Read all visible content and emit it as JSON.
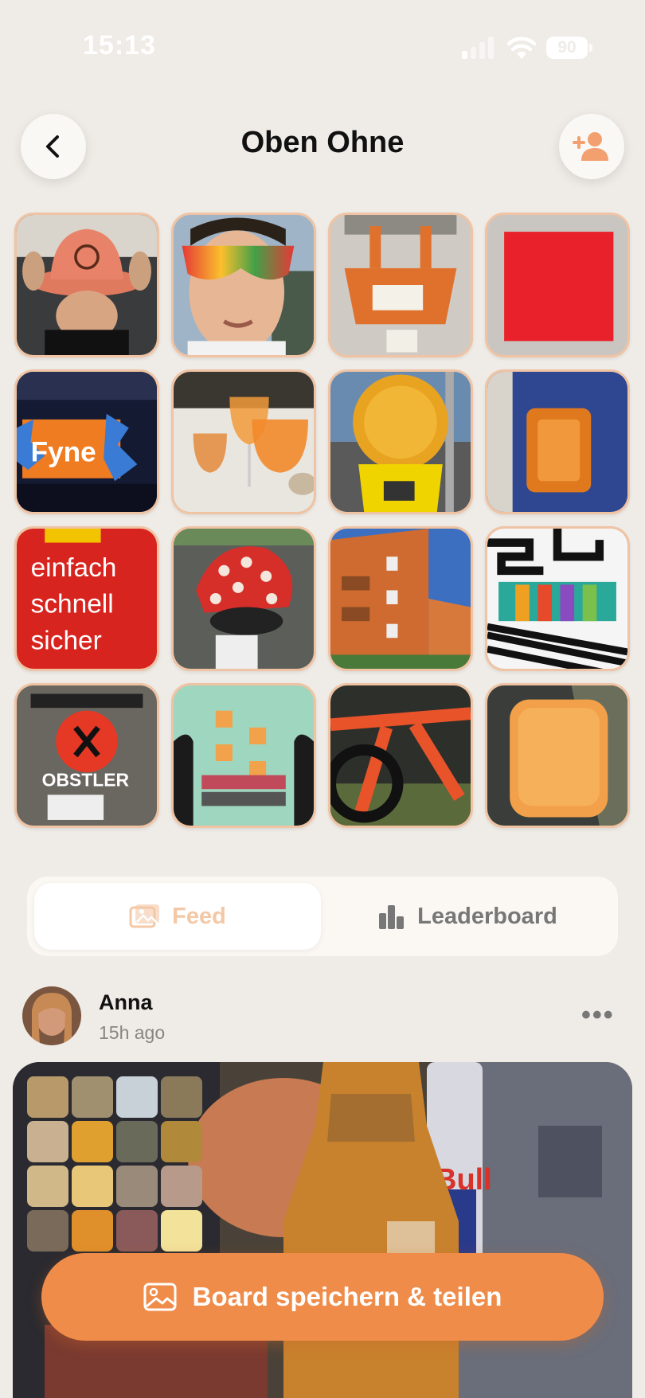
{
  "status_bar": {
    "time": "15:13",
    "battery": "90"
  },
  "header": {
    "title": "Oben Ohne",
    "back_icon": "chevron-left-icon",
    "add_member_icon": "person-plus-icon"
  },
  "grid": {
    "tiles": [
      {
        "name": "tile-bucket-hat"
      },
      {
        "name": "tile-sunglasses"
      },
      {
        "name": "tile-orange-bucket"
      },
      {
        "name": "tile-red-square"
      },
      {
        "name": "tile-concert-stage"
      },
      {
        "name": "tile-aperol-glasses"
      },
      {
        "name": "tile-warning-lamp"
      },
      {
        "name": "tile-orange-reflector"
      },
      {
        "name": "tile-sign-einfach"
      },
      {
        "name": "tile-red-bandana"
      },
      {
        "name": "tile-orange-building"
      },
      {
        "name": "tile-graffiti-wall"
      },
      {
        "name": "tile-obstler-sign"
      },
      {
        "name": "tile-tiles-wall"
      },
      {
        "name": "tile-orange-bike"
      },
      {
        "name": "tile-orange-seat"
      }
    ],
    "texts": {
      "fyne": "Fyne",
      "sign_lines": [
        "einfach",
        "schnell",
        "sicher"
      ],
      "obstler": "OBSTLER"
    }
  },
  "tabs": {
    "feed_label": "Feed",
    "leaderboard_label": "Leaderboard",
    "selected": "Feed"
  },
  "post": {
    "user": "Anna",
    "time_ago": "15h ago",
    "more_label": "•••",
    "bottle_text": "Bull"
  },
  "cta": {
    "label": "Board speichern & teilen"
  },
  "colors": {
    "background": "#efebe6",
    "accent": "#f08c4a",
    "tile_border": "#efc3a3"
  }
}
